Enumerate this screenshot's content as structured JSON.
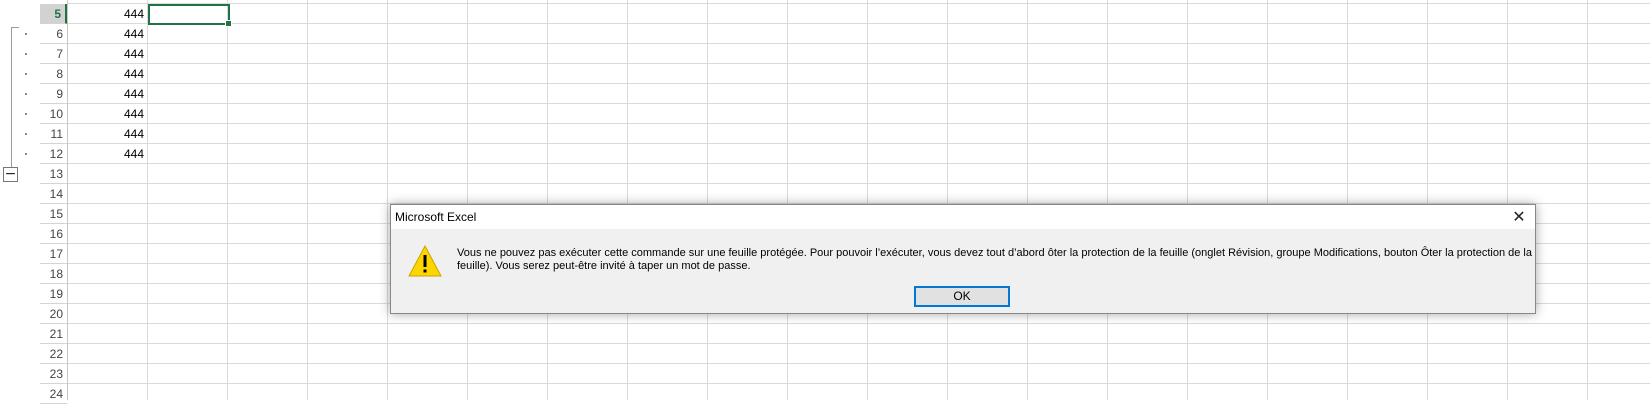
{
  "spreadsheet": {
    "rows": [
      {
        "number": "5",
        "value": "444"
      },
      {
        "number": "6",
        "value": "444"
      },
      {
        "number": "7",
        "value": "444"
      },
      {
        "number": "8",
        "value": "444"
      },
      {
        "number": "9",
        "value": "444"
      },
      {
        "number": "10",
        "value": "444"
      },
      {
        "number": "11",
        "value": "444"
      },
      {
        "number": "12",
        "value": "444"
      },
      {
        "number": "13",
        "value": ""
      },
      {
        "number": "14",
        "value": ""
      },
      {
        "number": "15",
        "value": ""
      },
      {
        "number": "16",
        "value": ""
      },
      {
        "number": "17",
        "value": ""
      },
      {
        "number": "18",
        "value": ""
      },
      {
        "number": "19",
        "value": ""
      },
      {
        "number": "20",
        "value": ""
      },
      {
        "number": "21",
        "value": ""
      },
      {
        "number": "22",
        "value": ""
      },
      {
        "number": "23",
        "value": ""
      },
      {
        "number": "24",
        "value": ""
      }
    ],
    "active_row": "5",
    "outline_collapse_symbol": "−",
    "accent_color": "#217346"
  },
  "dialog": {
    "title": "Microsoft Excel",
    "close_symbol": "✕",
    "icon": "warning-icon",
    "message": "Vous ne pouvez pas exécuter cette commande sur une feuille protégée. Pour pouvoir l’exécuter, vous devez tout d’abord ôter la protection de la feuille (onglet Révision, groupe Modifications, bouton Ôter la protection de la feuille). Vous serez peut-être invité à taper un mot de passe.",
    "ok_label": "OK"
  }
}
